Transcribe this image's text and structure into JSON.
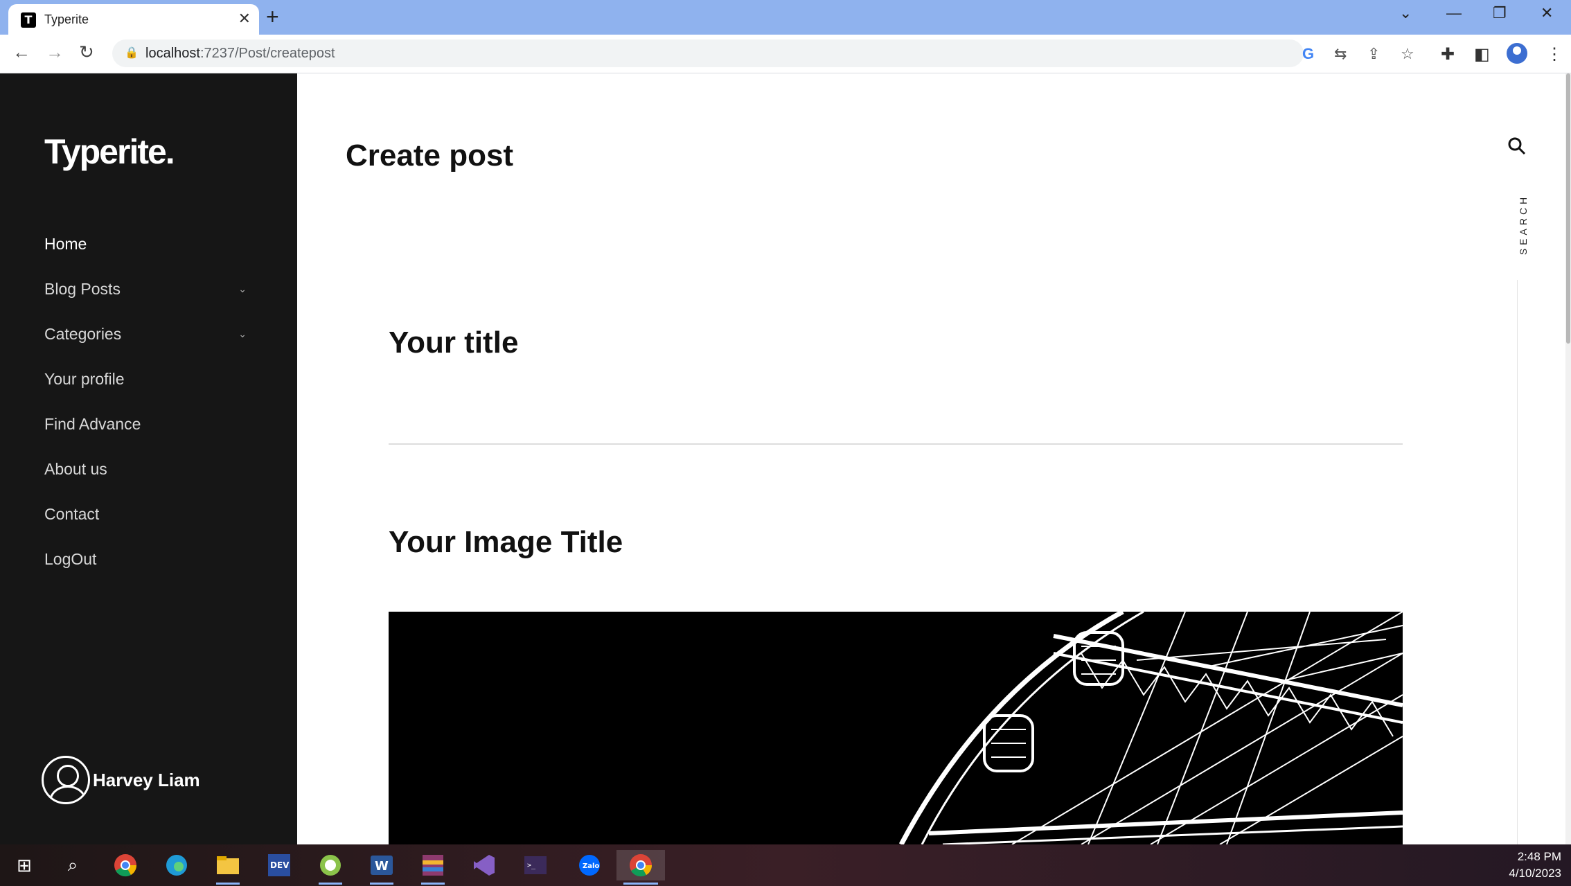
{
  "browser": {
    "tab_title": "Typerite",
    "tab_favicon": "T",
    "url_host": "localhost",
    "url_path": ":7237/Post/createpost"
  },
  "sidebar": {
    "logo": "Typerite.",
    "items": [
      {
        "label": "Home",
        "has_submenu": false
      },
      {
        "label": "Blog Posts",
        "has_submenu": true
      },
      {
        "label": "Categories",
        "has_submenu": true
      },
      {
        "label": "Your profile",
        "has_submenu": false
      },
      {
        "label": "Find Advance",
        "has_submenu": false
      },
      {
        "label": "About us",
        "has_submenu": false
      },
      {
        "label": "Contact",
        "has_submenu": false
      },
      {
        "label": "LogOut",
        "has_submenu": false
      }
    ],
    "user_name": "Harvey Liam"
  },
  "main": {
    "page_title": "Create post",
    "title_label": "Your title",
    "image_title_label": "Your Image Title",
    "search_label": "SEARCH"
  },
  "taskbar": {
    "time": "2:48 PM",
    "date": "4/10/2023"
  },
  "colors": {
    "sidebar_bg": "#161616",
    "tabstrip_bg": "#8fb2ee"
  }
}
